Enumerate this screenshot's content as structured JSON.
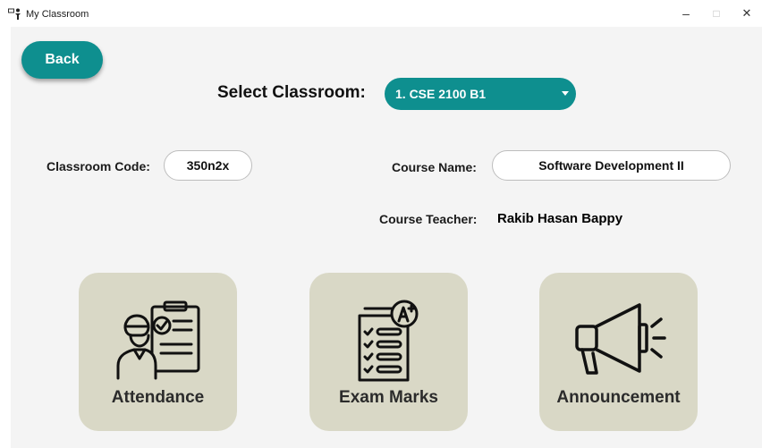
{
  "window": {
    "title": "My Classroom",
    "minimize_label": "–",
    "maximize_label": "□",
    "close_label": "✕"
  },
  "toolbar": {
    "back_label": "Back"
  },
  "classroom_select": {
    "label": "Select Classroom:",
    "selected_value": "1. CSE 2100 B1"
  },
  "classroom_code": {
    "label": "Classroom Code:",
    "value": "350n2x"
  },
  "course_name": {
    "label": "Course Name:",
    "value": "Software Development II"
  },
  "course_teacher": {
    "label": "Course Teacher:",
    "value": "Rakib Hasan Bappy"
  },
  "cards": [
    {
      "label": "Attendance",
      "icon": "attendance-clipboard-icon"
    },
    {
      "label": "Exam Marks",
      "icon": "exam-marks-checklist-icon"
    },
    {
      "label": "Announcement",
      "icon": "megaphone-icon"
    }
  ],
  "colors": {
    "accent": "#0e8f8f",
    "card_background": "#d9d8c6",
    "content_background": "#f4f4f4"
  }
}
